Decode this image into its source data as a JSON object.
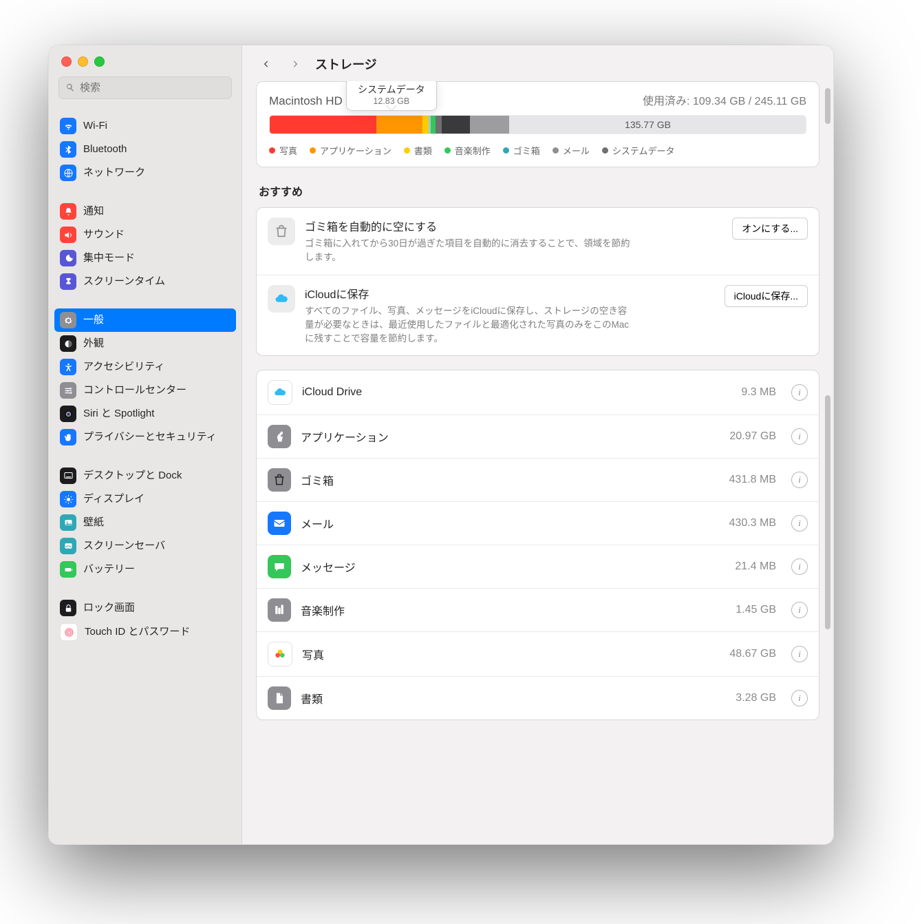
{
  "header": {
    "title": "ストレージ"
  },
  "search": {
    "placeholder": "検索"
  },
  "tooltip": {
    "title": "システムデータ",
    "value": "12.83 GB"
  },
  "disk": {
    "name": "Macintosh HD",
    "used_label": "使用済み: 109.34 GB / 245.11 GB",
    "free_label": "135.77 GB",
    "bar": [
      {
        "color": "#ff3b30",
        "flex": 49
      },
      {
        "color": "#ff9500",
        "flex": 21
      },
      {
        "color": "#ffcc00",
        "flex": 3
      },
      {
        "color": "#8fd3d8",
        "flex": 1
      },
      {
        "color": "#34c759",
        "flex": 2
      },
      {
        "color": "#6f6f72",
        "flex": 3
      },
      {
        "color": "#3a3a3c",
        "flex": 13
      },
      {
        "color": "#9d9da0",
        "flex": 18
      },
      {
        "color": "#e6e6e8",
        "flex": 136
      }
    ],
    "legend": [
      {
        "color": "#ff3b30",
        "label": "写真"
      },
      {
        "color": "#ff9500",
        "label": "アプリケーション"
      },
      {
        "color": "#ffcc00",
        "label": "書類"
      },
      {
        "color": "#34c759",
        "label": "音楽制作"
      },
      {
        "color": "#2fa8b5",
        "label": "ゴミ箱"
      },
      {
        "color": "#8e8e93",
        "label": "メール"
      },
      {
        "color": "#6f6f72",
        "label": "システムデータ"
      }
    ]
  },
  "sidebar": {
    "groups": [
      [
        {
          "label": "Wi-Fi",
          "bg": "bg-blue",
          "icon": "wifi"
        },
        {
          "label": "Bluetooth",
          "bg": "bg-blue",
          "icon": "bluetooth"
        },
        {
          "label": "ネットワーク",
          "bg": "bg-blue",
          "icon": "globe"
        }
      ],
      [
        {
          "label": "通知",
          "bg": "bg-red",
          "icon": "bell"
        },
        {
          "label": "サウンド",
          "bg": "bg-red",
          "icon": "sound"
        },
        {
          "label": "集中モード",
          "bg": "bg-purple",
          "icon": "moon"
        },
        {
          "label": "スクリーンタイム",
          "bg": "bg-purple",
          "icon": "hourglass"
        }
      ],
      [
        {
          "label": "一般",
          "bg": "bg-gray",
          "icon": "gear",
          "active": true
        },
        {
          "label": "外観",
          "bg": "bg-black",
          "icon": "appearance"
        },
        {
          "label": "アクセシビリティ",
          "bg": "bg-blue",
          "icon": "accessibility"
        },
        {
          "label": "コントロールセンター",
          "bg": "bg-gray",
          "icon": "sliders"
        },
        {
          "label": "Siri と Spotlight",
          "bg": "bg-black",
          "icon": "siri"
        },
        {
          "label": "プライバシーとセキュリティ",
          "bg": "bg-blue",
          "icon": "hand",
          "wrap": true
        }
      ],
      [
        {
          "label": "デスクトップと Dock",
          "bg": "bg-black",
          "icon": "dock"
        },
        {
          "label": "ディスプレイ",
          "bg": "bg-blue",
          "icon": "display"
        },
        {
          "label": "壁紙",
          "bg": "bg-teal",
          "icon": "wallpaper"
        },
        {
          "label": "スクリーンセーバ",
          "bg": "bg-teal",
          "icon": "screensaver"
        },
        {
          "label": "バッテリー",
          "bg": "bg-green",
          "icon": "battery"
        }
      ],
      [
        {
          "label": "ロック画面",
          "bg": "bg-black",
          "icon": "lock"
        },
        {
          "label": "Touch ID とパスワード",
          "bg": "bg-white2",
          "icon": "touchid"
        }
      ]
    ]
  },
  "recommend": {
    "title": "おすすめ",
    "items": [
      {
        "icon": "trash",
        "title": "ゴミ箱を自動的に空にする",
        "desc": "ゴミ箱に入れてから30日が過ぎた項目を自動的に消去することで、領域を節約します。",
        "button": "オンにする..."
      },
      {
        "icon": "icloud",
        "title": "iCloudに保存",
        "desc": "すべてのファイル、写真、メッセージをiCloudに保存し、ストレージの空き容量が必要なときは、最近使用したファイルと最適化された写真のみをこのMacに残すことで容量を節約します。",
        "button": "iCloudに保存..."
      }
    ]
  },
  "storage_rows": [
    {
      "icon": "icloud",
      "bg": "bg-white2",
      "label": "iCloud Drive",
      "size": "9.3 MB"
    },
    {
      "icon": "apps",
      "bg": "bg-gray",
      "label": "アプリケーション",
      "size": "20.97 GB"
    },
    {
      "icon": "trash",
      "bg": "bg-gray",
      "label": "ゴミ箱",
      "size": "431.8 MB"
    },
    {
      "icon": "mail",
      "bg": "bg-blue",
      "label": "メール",
      "size": "430.3 MB"
    },
    {
      "icon": "messages",
      "bg": "bg-green",
      "label": "メッセージ",
      "size": "21.4 MB"
    },
    {
      "icon": "music",
      "bg": "bg-gray",
      "label": "音楽制作",
      "size": "1.45 GB"
    },
    {
      "icon": "photos",
      "bg": "bg-white2",
      "label": "写真",
      "size": "48.67 GB"
    },
    {
      "icon": "doc",
      "bg": "bg-gray",
      "label": "書類",
      "size": "3.28 GB"
    }
  ]
}
